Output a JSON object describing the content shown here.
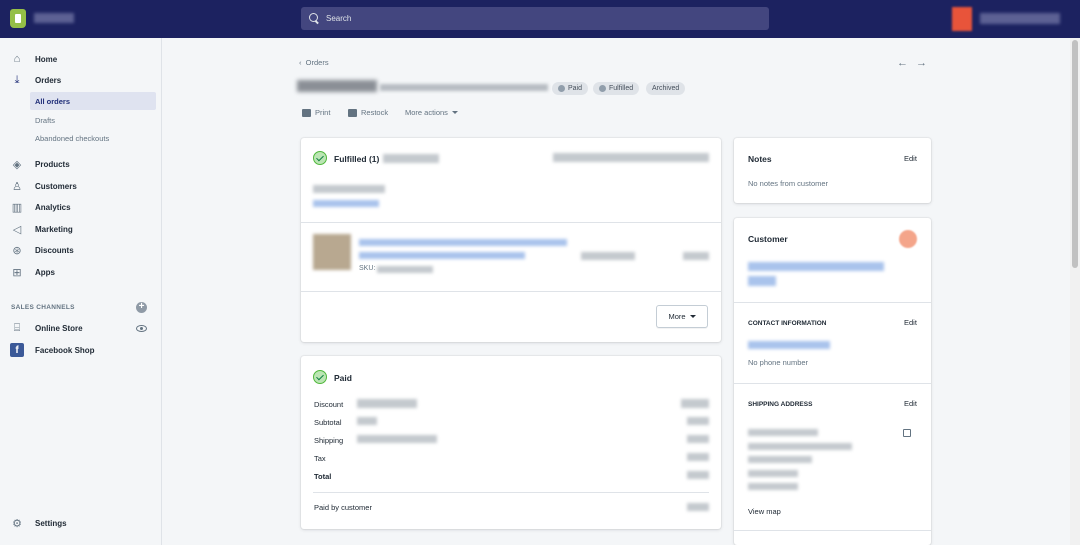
{
  "search": {
    "placeholder": "Search"
  },
  "sidebar": {
    "items": [
      {
        "label": "Home",
        "icon": "home-icon"
      },
      {
        "label": "Orders",
        "icon": "orders-icon"
      },
      {
        "label": "Products",
        "icon": "tag-icon"
      },
      {
        "label": "Customers",
        "icon": "person-icon"
      },
      {
        "label": "Analytics",
        "icon": "bar-chart-icon"
      },
      {
        "label": "Marketing",
        "icon": "megaphone-icon"
      },
      {
        "label": "Discounts",
        "icon": "discount-icon"
      },
      {
        "label": "Apps",
        "icon": "apps-icon"
      }
    ],
    "orders_sub": [
      "All orders",
      "Drafts",
      "Abandoned checkouts"
    ],
    "sales_channels_heading": "SALES CHANNELS",
    "channels": [
      {
        "label": "Online Store",
        "icon": "store-icon"
      },
      {
        "label": "Facebook Shop",
        "icon": "facebook-icon"
      }
    ],
    "settings": "Settings"
  },
  "header": {
    "breadcrumb": "Orders",
    "badges": [
      "Paid",
      "Fulfilled",
      "Archived"
    ],
    "actions": {
      "print": "Print",
      "restock": "Restock",
      "more": "More actions"
    }
  },
  "fulfilled_card": {
    "title": "Fulfilled (1)",
    "sku_label": "SKU:",
    "more_button": "More"
  },
  "paid_card": {
    "title": "Paid",
    "rows": [
      "Discount",
      "Subtotal",
      "Shipping",
      "Tax",
      "Total"
    ],
    "paid_by": "Paid by customer"
  },
  "notes_card": {
    "title": "Notes",
    "edit": "Edit",
    "body": "No notes from customer"
  },
  "customer_card": {
    "title": "Customer",
    "contact_heading": "CONTACT INFORMATION",
    "contact_edit": "Edit",
    "no_phone": "No phone number",
    "shipping_heading": "SHIPPING ADDRESS",
    "shipping_edit": "Edit",
    "view_map": "View map"
  },
  "colors": {
    "topbar": "#1c2260",
    "accent_link": "#007ace",
    "success": "#50b83c",
    "logo": "#95bf47"
  }
}
